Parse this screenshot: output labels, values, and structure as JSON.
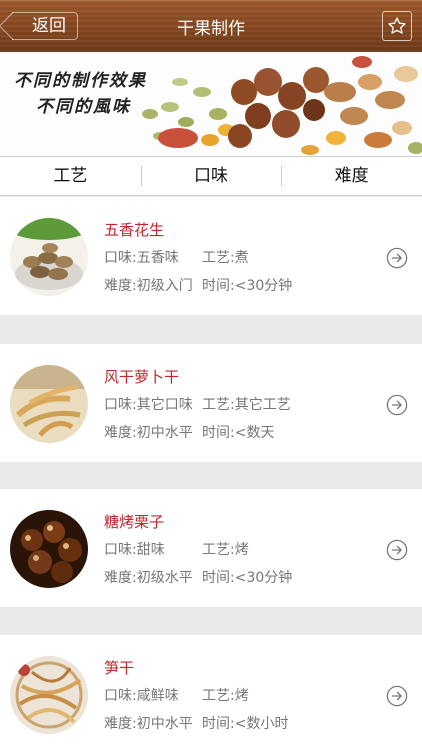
{
  "nav": {
    "back_label": "返回",
    "title": "干果制作",
    "favorite_icon": "star-icon"
  },
  "banner": {
    "line1": "不同的制作效果",
    "line2": "不同的風味"
  },
  "tabs": [
    {
      "label": "工艺"
    },
    {
      "label": "口味"
    },
    {
      "label": "难度"
    }
  ],
  "recipes": [
    {
      "name": "五香花生",
      "taste": "口味:五香味",
      "craft": "工艺:煮",
      "difficulty": "难度:初级入门",
      "time": "时间:<30分钟"
    },
    {
      "name": "风干萝卜干",
      "taste": "口味:其它口味",
      "craft": "工艺:其它工艺",
      "difficulty": "难度:初中水平",
      "time": "时间:<数天"
    },
    {
      "name": "糖烤栗子",
      "taste": "口味:甜味",
      "craft": "工艺:烤",
      "difficulty": "难度:初级水平",
      "time": "时间:<30分钟"
    },
    {
      "name": "笋干",
      "taste": "口味:咸鲜味",
      "craft": "工艺:烤",
      "difficulty": "难度:初中水平",
      "time": "时间:<数小时"
    }
  ],
  "colors": {
    "accent": "#c1272d",
    "nav": "#8a4a22",
    "muted": "#777777"
  }
}
